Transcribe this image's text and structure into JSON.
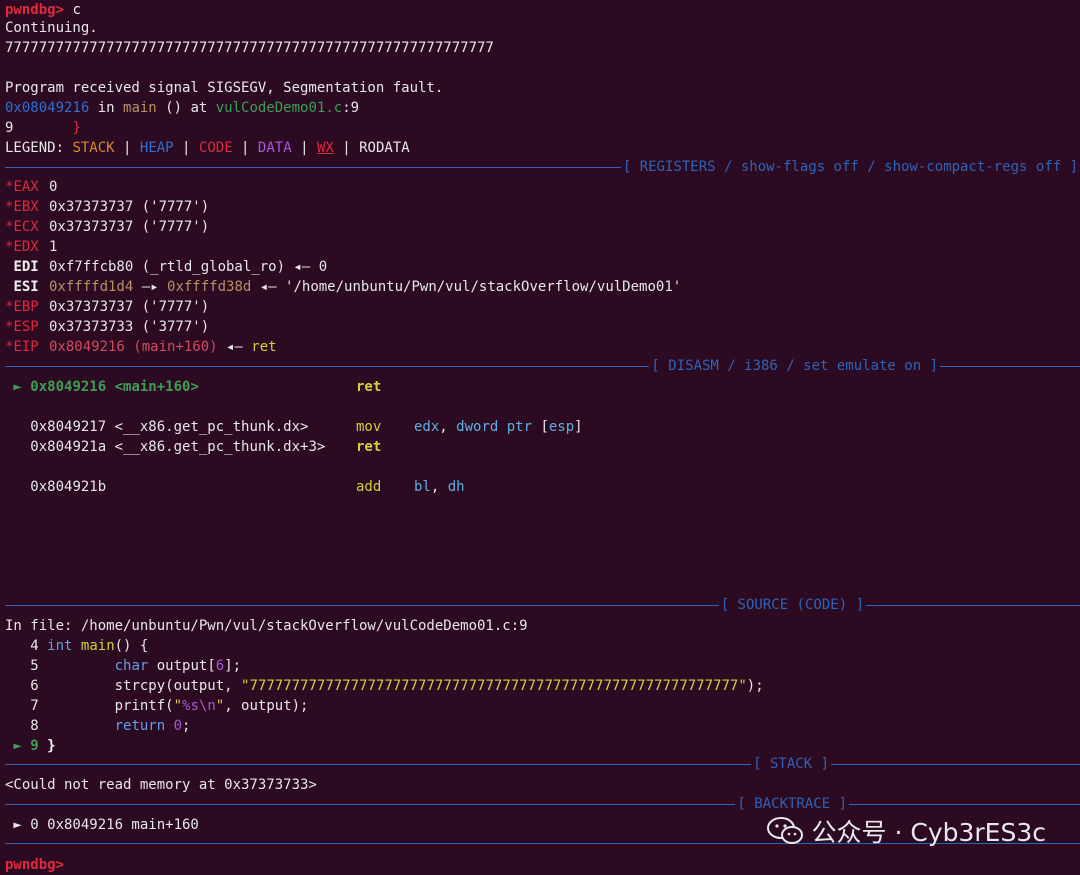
{
  "prompt": "pwndbg> ",
  "command": "c",
  "continuing": "Continuing.",
  "program_output": "7777777777777777777777777777777777777777777777777777777777",
  "signal_line": "Program received signal SIGSEGV, Segmentation fault.",
  "location": {
    "addr": "0x08049216",
    "in": " in ",
    "func": "main",
    "mid": " () at ",
    "file": "vulCodeDemo01.c",
    "line": ":9"
  },
  "src_line_9": {
    "num": "9",
    "text": "       }"
  },
  "legend": {
    "prefix": "LEGEND: ",
    "items": [
      "STACK",
      "HEAP",
      "CODE",
      "DATA",
      "WX",
      "RODATA"
    ],
    "sep": " | "
  },
  "sections": {
    "registers": "[ REGISTERS / show-flags off / show-compact-regs off ]",
    "disasm": "[ DISASM / i386 / set emulate on ]",
    "source": "[ SOURCE (CODE) ]",
    "stack": "[ STACK ]",
    "backtrace": "[ BACKTRACE ]"
  },
  "registers": [
    {
      "star": "*",
      "name": "EAX",
      "value": "0"
    },
    {
      "star": "*",
      "name": "EBX",
      "value": "0x37373737 ('7777')"
    },
    {
      "star": "*",
      "name": "ECX",
      "value": "0x37373737 ('7777')"
    },
    {
      "star": "*",
      "name": "EDX",
      "value": "1"
    },
    {
      "star": " ",
      "name": "EDI",
      "value": "0xf7ffcb80 (_rtld_global_ro) ◂— 0"
    },
    {
      "star": " ",
      "name": "ESI",
      "value_a": "0xffffd1d4",
      "arrow": " —▸ ",
      "value_b": "0xffffd38d",
      "rest": " ◂— '/home/unbuntu/Pwn/vul/stackOverflow/vulDemo01'"
    },
    {
      "star": "*",
      "name": "EBP",
      "value": "0x37373737 ('7777')"
    },
    {
      "star": "*",
      "name": "ESP",
      "value": "0x37373733 ('3777')"
    },
    {
      "star": "*",
      "name": "EIP",
      "value_a": "0x8049216 (main+160)",
      "rest_a": " ◂— ",
      "rest_b": "ret"
    }
  ],
  "disasm": [
    {
      "marker": " ► ",
      "addr": "0x8049216",
      "sym": "<main+160>",
      "op": "ret",
      "args": ""
    },
    {
      "marker": "   ",
      "addr": "0x8049217",
      "sym": "<__x86.get_pc_thunk.dx>",
      "op": "mov",
      "args": ""
    },
    {
      "marker": "   ",
      "addr": "0x804921a",
      "sym": "<__x86.get_pc_thunk.dx+3>",
      "op": "ret",
      "args": ""
    },
    {
      "marker": "   ",
      "addr": "0x804921b",
      "sym": "",
      "op": "add",
      "args": ""
    }
  ],
  "disasm_args": {
    "mov_a": "edx",
    "mov_b": ", ",
    "mov_c": "dword ptr",
    "mov_d": " [",
    "mov_e": "esp",
    "mov_f": "]",
    "add_a": "bl",
    "add_b": ", ",
    "add_c": "dh"
  },
  "source": {
    "in_file": "In file: /home/unbuntu/Pwn/vul/stackOverflow/vulCodeDemo01.c:9",
    "lines": [
      {
        "num": "4",
        "code": "int main() {"
      },
      {
        "num": "5",
        "code": "char output[6];"
      },
      {
        "num": "6",
        "code": "strcpy(output, \"7777777777777777777777777777777777777777777777777777777777\");"
      },
      {
        "num": "7",
        "code": "printf(\"%s\\n\", output);"
      },
      {
        "num": "8",
        "code": "return 0;"
      },
      {
        "num": "9",
        "code": "}"
      }
    ],
    "current_marker": " ► ",
    "l4_kw": "int",
    "l4_fn": "main",
    "l4_rest": "() {",
    "l5_kw": "char",
    "l5_a": " output[",
    "l5_num": "6",
    "l5_b": "];",
    "l6_a": "strcpy(output, ",
    "l6_str": "\"7777777777777777777777777777777777777777777777777777777777\"",
    "l6_b": ");",
    "l7_a": "printf(",
    "l7_s1": "\"",
    "l7_fmt": "%s\\n",
    "l7_s2": "\"",
    "l7_b": ", output);",
    "l8_kw": "return",
    "l8_num": "0",
    "l8_b": ";",
    "l9_code": "}"
  },
  "stack_line": "<Could not read memory at 0x37373733>",
  "backtrace_line": " ► 0 0x8049216 main+160",
  "watermark": "公众号 · Cyb3rES3c",
  "colors": {
    "background": "#2b0a22",
    "section": "#2f63b7",
    "prompt": "#e0293d"
  }
}
